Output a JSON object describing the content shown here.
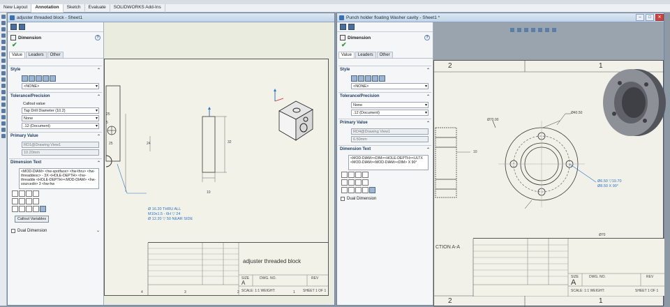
{
  "tabs": [
    "New Layout",
    "Annotation",
    "Sketch",
    "Evaluate",
    "SOLIDWORKS Add-Ins"
  ],
  "active_tab": "Annotation",
  "left_window": {
    "title": "adjuster threaded block - Sheet1",
    "pm": {
      "title": "Dimension",
      "help": "?",
      "ok": "✔",
      "tabs": [
        "Value",
        "Leaders",
        "Other"
      ],
      "style_group": "Style",
      "style_value": "<NONE>",
      "tolerance_group": "Tolerance/Precision",
      "callout_label": "Callout value",
      "callout_value": "Tap Drill Diameter (10.2)",
      "tol_value": "None",
      "precision_value": ".12 (Document)",
      "primary_group": "Primary Value",
      "primary_ref": "RD1@Drawing View1",
      "primary_val": "10.20mm",
      "dimtext_group": "Dimension Text",
      "dimtext": "<MOD-DIAM> <hw-spotface> <hw-thru> <hw-threaddesc> - 3X <HOLE-DEPTH> <hw-threadde <HOLE-DEPTH><MOD-DIAM> <hw-sourcedir> 3 <hw-hw",
      "callout_button": "Callout Variables",
      "dual": "Dual Dimension"
    },
    "drawing": {
      "hole_callout": [
        "Ø 16.20 THRU ALL",
        "M10x1.5 - 6H ▽ 24",
        "Ø 12.20 ▽ 50 NEAR SIDE"
      ],
      "dims": [
        "25",
        "5",
        "25",
        "24",
        "10",
        "32"
      ],
      "title": "adjuster threaded block",
      "size": "A",
      "scale": "SCALE: 1:1  WEIGHT:",
      "sheet": "SHEET 1 OF 1",
      "dwg": "DWG. NO.",
      "rev": "REV",
      "zones": [
        "4",
        "3",
        "2",
        "1"
      ]
    }
  },
  "right_window": {
    "title": "Punch holder floating Washer cavity - Sheet1 *",
    "pm": {
      "title": "Dimension",
      "help": "?",
      "ok": "✔",
      "tabs": [
        "Value",
        "Leaders",
        "Other"
      ],
      "style_group": "Style",
      "style_value": "<NONE>",
      "tolerance_group": "Tolerance/Precision",
      "tol_value": "None",
      "precision_value": ".12 (Document)",
      "primary_group": "Primary Value",
      "primary_ref": "RD4@Drawing View1",
      "primary_val": "6.50mm",
      "dimtext_group": "Dimension Text",
      "dimtext": "<MOD-DIAM><DIM><HOLE-DEPTH><ULTX <MOD-DIAM><MOD-DIAM><DIM> X 90°",
      "dual": "Dual Dimension"
    },
    "drawing": {
      "zones_top": [
        "2",
        "1"
      ],
      "zones_bottom": [
        "2",
        "1"
      ],
      "dims": [
        "Ø70.00",
        "Ø40.50",
        "Ø70",
        "10"
      ],
      "hole_callout": [
        "Ø6.50 ▽19.70",
        "Ø8.50 X 90°"
      ],
      "section": "CTION A-A",
      "size": "A",
      "scale": "SCALE: 1:1  WEIGHT:",
      "sheet": "SHEET 1 OF 1",
      "dwg": "DWG. NO.",
      "rev": "REV"
    }
  },
  "colors": {
    "annotation_arrow": "#d42020",
    "dimension_blue": "#2a74c9"
  }
}
